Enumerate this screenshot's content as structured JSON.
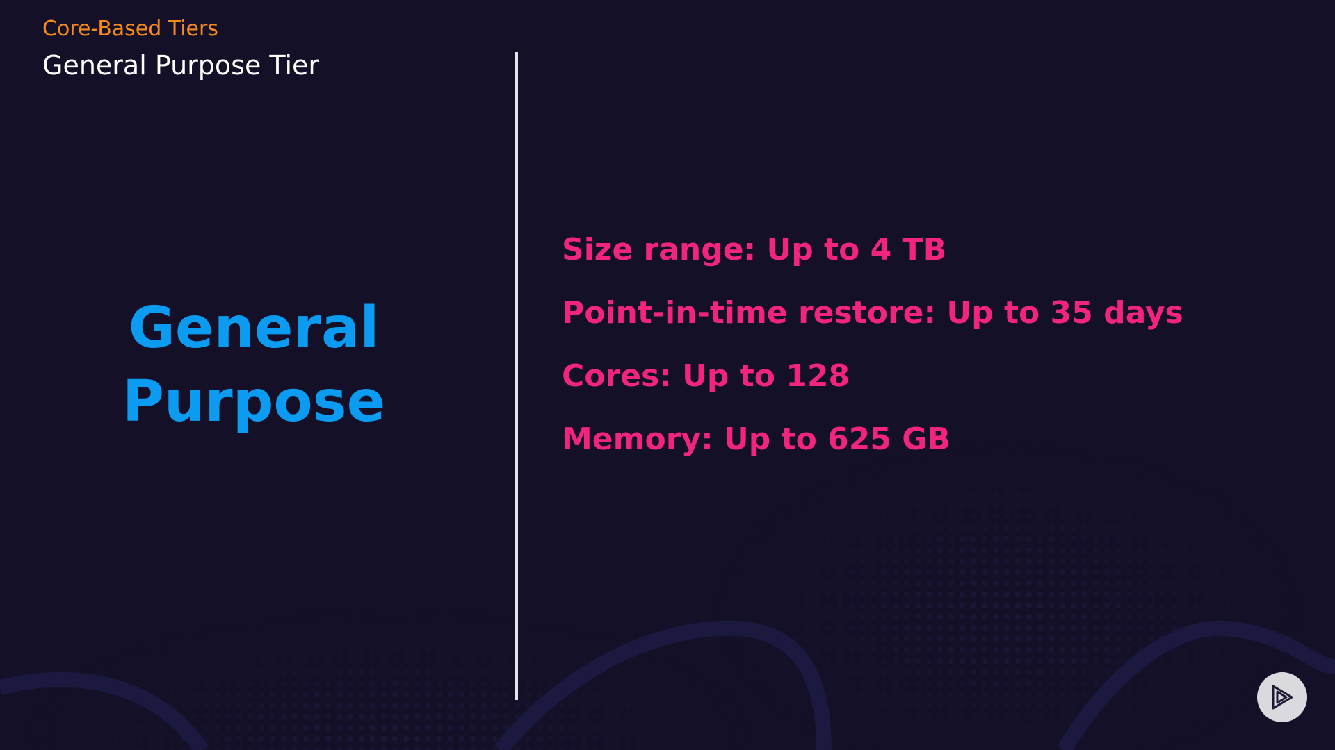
{
  "header": {
    "kicker": "Core-Based Tiers",
    "title": "General Purpose Tier"
  },
  "main": {
    "title_line1": "General",
    "title_line2": "Purpose",
    "facts": [
      "Size range: Up to 4 TB",
      "Point-in-time restore: Up to 35 days",
      "Cores: Up to 128",
      "Memory: Up to 625 GB"
    ]
  },
  "controls": {
    "play_icon": "play-icon"
  },
  "colors": {
    "background": "#131027",
    "kicker": "#f58a1f",
    "title": "#ffffff",
    "big_title": "#0b9cf2",
    "facts": "#f2257d",
    "divider": "#e6e6ea"
  }
}
